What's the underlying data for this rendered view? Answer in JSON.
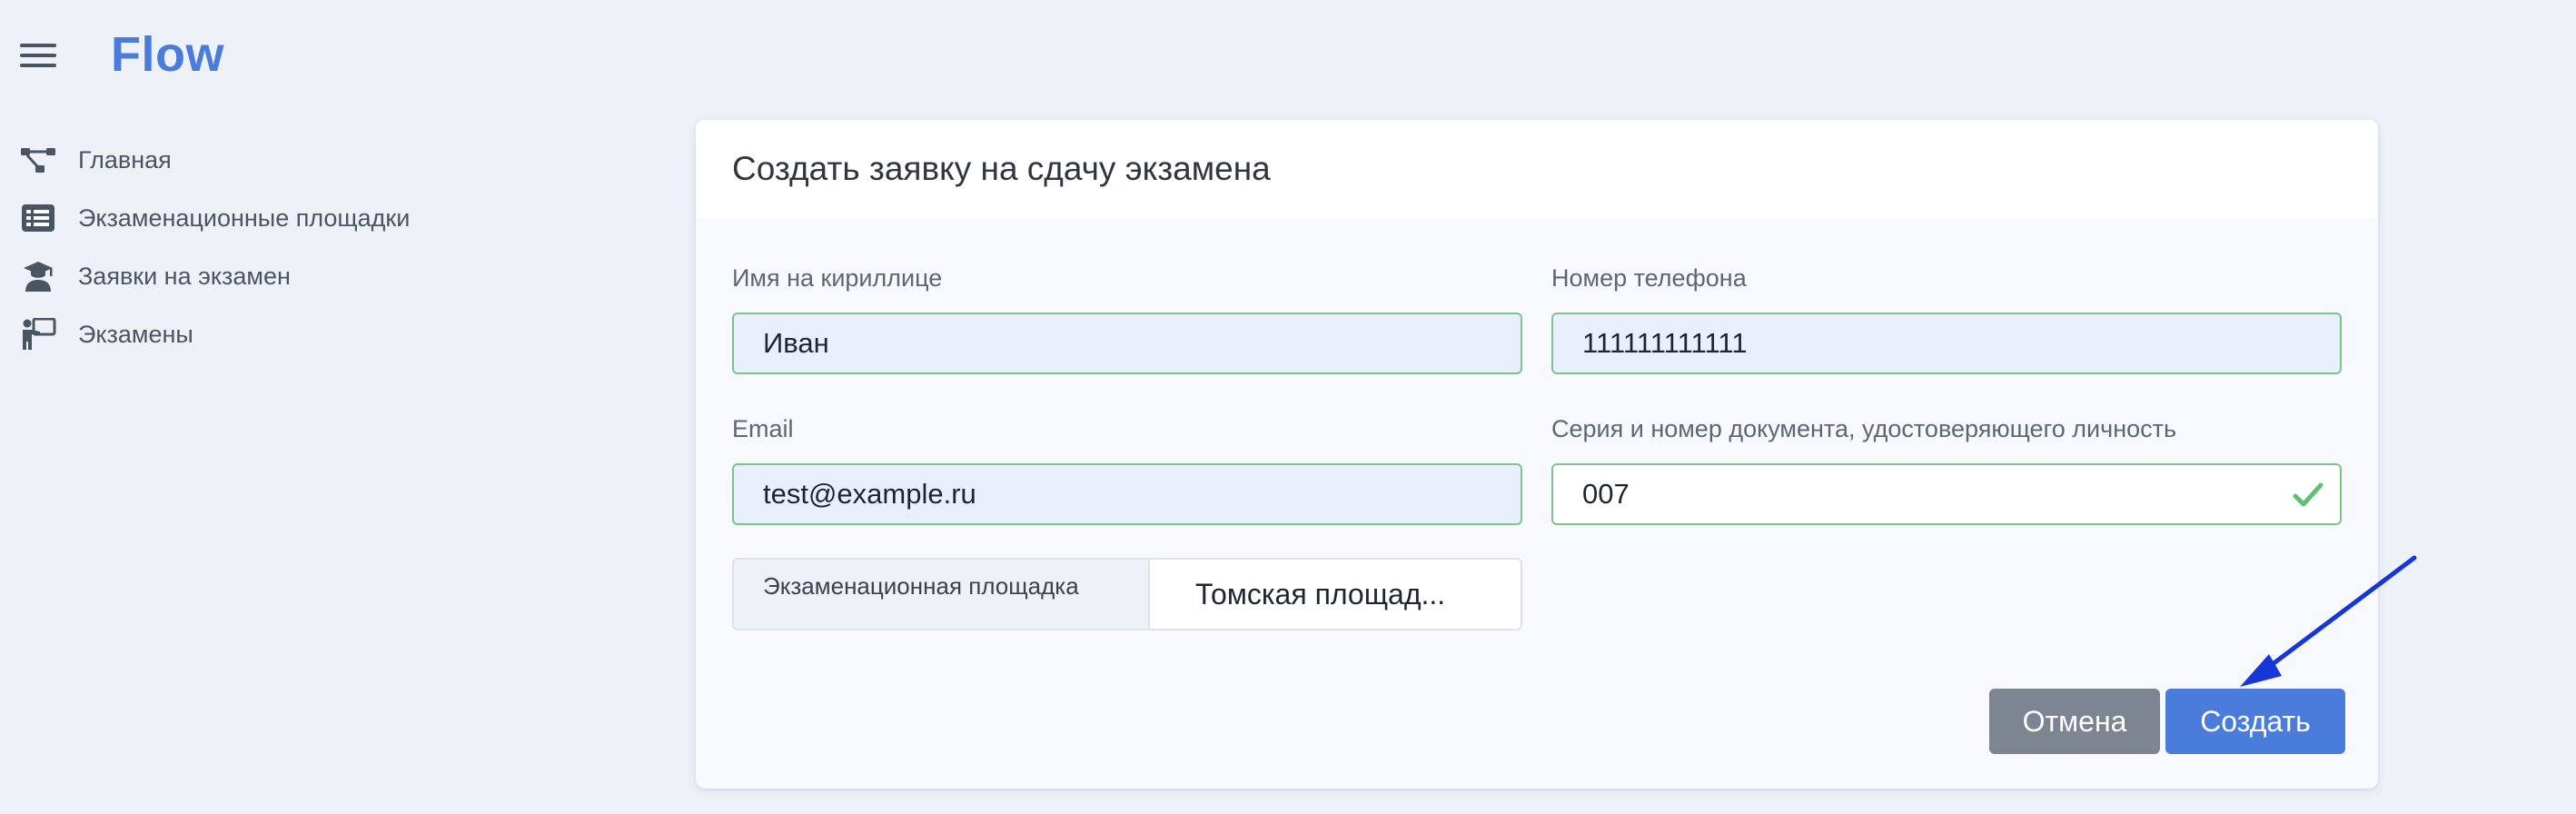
{
  "app": {
    "title": "Flow"
  },
  "sidebar": {
    "items": [
      {
        "label": "Главная",
        "icon": "flow-diagram-icon"
      },
      {
        "label": "Экзаменационные площадки",
        "icon": "list-icon"
      },
      {
        "label": "Заявки на экзамен",
        "icon": "graduate-icon"
      },
      {
        "label": "Экзамены",
        "icon": "teacher-board-icon"
      }
    ]
  },
  "modal": {
    "title": "Создать заявку на сдачу экзамена",
    "fields": {
      "name": {
        "label": "Имя на кириллице",
        "value": "Иван"
      },
      "phone": {
        "label": "Номер телефона",
        "value": "111111111111"
      },
      "email": {
        "label": "Email",
        "value": "test@example.ru"
      },
      "document": {
        "label": "Серия и номер документа, удостоверяющего личность",
        "value": "007"
      }
    },
    "site_select": {
      "label": "Экзаменационная площадка",
      "value": "Томская площад..."
    },
    "buttons": {
      "cancel": "Отмена",
      "create": "Создать"
    }
  },
  "colors": {
    "brand": "#4a7ddb",
    "valid_border": "#7cc489",
    "cancel_button": "#7c8591",
    "annotation_arrow": "#1537d9"
  }
}
